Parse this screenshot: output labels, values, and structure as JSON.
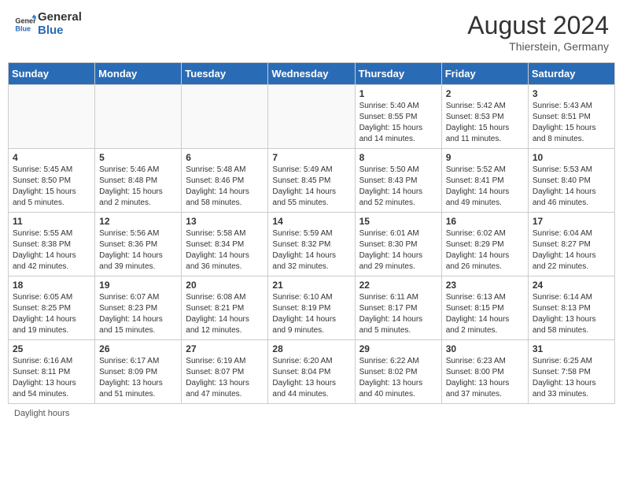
{
  "header": {
    "logo_line1": "General",
    "logo_line2": "Blue",
    "month_year": "August 2024",
    "location": "Thierstein, Germany"
  },
  "weekdays": [
    "Sunday",
    "Monday",
    "Tuesday",
    "Wednesday",
    "Thursday",
    "Friday",
    "Saturday"
  ],
  "weeks": [
    [
      {
        "day": "",
        "info": ""
      },
      {
        "day": "",
        "info": ""
      },
      {
        "day": "",
        "info": ""
      },
      {
        "day": "",
        "info": ""
      },
      {
        "day": "1",
        "info": "Sunrise: 5:40 AM\nSunset: 8:55 PM\nDaylight: 15 hours\nand 14 minutes."
      },
      {
        "day": "2",
        "info": "Sunrise: 5:42 AM\nSunset: 8:53 PM\nDaylight: 15 hours\nand 11 minutes."
      },
      {
        "day": "3",
        "info": "Sunrise: 5:43 AM\nSunset: 8:51 PM\nDaylight: 15 hours\nand 8 minutes."
      }
    ],
    [
      {
        "day": "4",
        "info": "Sunrise: 5:45 AM\nSunset: 8:50 PM\nDaylight: 15 hours\nand 5 minutes."
      },
      {
        "day": "5",
        "info": "Sunrise: 5:46 AM\nSunset: 8:48 PM\nDaylight: 15 hours\nand 2 minutes."
      },
      {
        "day": "6",
        "info": "Sunrise: 5:48 AM\nSunset: 8:46 PM\nDaylight: 14 hours\nand 58 minutes."
      },
      {
        "day": "7",
        "info": "Sunrise: 5:49 AM\nSunset: 8:45 PM\nDaylight: 14 hours\nand 55 minutes."
      },
      {
        "day": "8",
        "info": "Sunrise: 5:50 AM\nSunset: 8:43 PM\nDaylight: 14 hours\nand 52 minutes."
      },
      {
        "day": "9",
        "info": "Sunrise: 5:52 AM\nSunset: 8:41 PM\nDaylight: 14 hours\nand 49 minutes."
      },
      {
        "day": "10",
        "info": "Sunrise: 5:53 AM\nSunset: 8:40 PM\nDaylight: 14 hours\nand 46 minutes."
      }
    ],
    [
      {
        "day": "11",
        "info": "Sunrise: 5:55 AM\nSunset: 8:38 PM\nDaylight: 14 hours\nand 42 minutes."
      },
      {
        "day": "12",
        "info": "Sunrise: 5:56 AM\nSunset: 8:36 PM\nDaylight: 14 hours\nand 39 minutes."
      },
      {
        "day": "13",
        "info": "Sunrise: 5:58 AM\nSunset: 8:34 PM\nDaylight: 14 hours\nand 36 minutes."
      },
      {
        "day": "14",
        "info": "Sunrise: 5:59 AM\nSunset: 8:32 PM\nDaylight: 14 hours\nand 32 minutes."
      },
      {
        "day": "15",
        "info": "Sunrise: 6:01 AM\nSunset: 8:30 PM\nDaylight: 14 hours\nand 29 minutes."
      },
      {
        "day": "16",
        "info": "Sunrise: 6:02 AM\nSunset: 8:29 PM\nDaylight: 14 hours\nand 26 minutes."
      },
      {
        "day": "17",
        "info": "Sunrise: 6:04 AM\nSunset: 8:27 PM\nDaylight: 14 hours\nand 22 minutes."
      }
    ],
    [
      {
        "day": "18",
        "info": "Sunrise: 6:05 AM\nSunset: 8:25 PM\nDaylight: 14 hours\nand 19 minutes."
      },
      {
        "day": "19",
        "info": "Sunrise: 6:07 AM\nSunset: 8:23 PM\nDaylight: 14 hours\nand 15 minutes."
      },
      {
        "day": "20",
        "info": "Sunrise: 6:08 AM\nSunset: 8:21 PM\nDaylight: 14 hours\nand 12 minutes."
      },
      {
        "day": "21",
        "info": "Sunrise: 6:10 AM\nSunset: 8:19 PM\nDaylight: 14 hours\nand 9 minutes."
      },
      {
        "day": "22",
        "info": "Sunrise: 6:11 AM\nSunset: 8:17 PM\nDaylight: 14 hours\nand 5 minutes."
      },
      {
        "day": "23",
        "info": "Sunrise: 6:13 AM\nSunset: 8:15 PM\nDaylight: 14 hours\nand 2 minutes."
      },
      {
        "day": "24",
        "info": "Sunrise: 6:14 AM\nSunset: 8:13 PM\nDaylight: 13 hours\nand 58 minutes."
      }
    ],
    [
      {
        "day": "25",
        "info": "Sunrise: 6:16 AM\nSunset: 8:11 PM\nDaylight: 13 hours\nand 54 minutes."
      },
      {
        "day": "26",
        "info": "Sunrise: 6:17 AM\nSunset: 8:09 PM\nDaylight: 13 hours\nand 51 minutes."
      },
      {
        "day": "27",
        "info": "Sunrise: 6:19 AM\nSunset: 8:07 PM\nDaylight: 13 hours\nand 47 minutes."
      },
      {
        "day": "28",
        "info": "Sunrise: 6:20 AM\nSunset: 8:04 PM\nDaylight: 13 hours\nand 44 minutes."
      },
      {
        "day": "29",
        "info": "Sunrise: 6:22 AM\nSunset: 8:02 PM\nDaylight: 13 hours\nand 40 minutes."
      },
      {
        "day": "30",
        "info": "Sunrise: 6:23 AM\nSunset: 8:00 PM\nDaylight: 13 hours\nand 37 minutes."
      },
      {
        "day": "31",
        "info": "Sunrise: 6:25 AM\nSunset: 7:58 PM\nDaylight: 13 hours\nand 33 minutes."
      }
    ]
  ],
  "footer": {
    "daylight_label": "Daylight hours"
  }
}
